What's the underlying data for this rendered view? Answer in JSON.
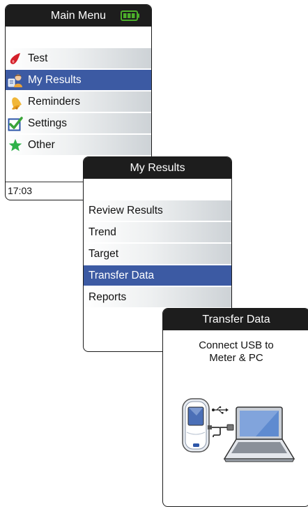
{
  "main_menu": {
    "title": "Main Menu",
    "items": [
      {
        "label": "Test",
        "icon": "blood-drop-icon"
      },
      {
        "label": "My Results",
        "icon": "user-results-icon",
        "selected": true
      },
      {
        "label": "Reminders",
        "icon": "bell-icon"
      },
      {
        "label": "Settings",
        "icon": "checkmark-icon"
      },
      {
        "label": "Other",
        "icon": "star-icon"
      }
    ],
    "time": "17:03",
    "battery_level": 1.0
  },
  "my_results": {
    "title": "My Results",
    "items": [
      {
        "label": "Review Results"
      },
      {
        "label": "Trend"
      },
      {
        "label": "Target"
      },
      {
        "label": "Transfer Data",
        "selected": true
      },
      {
        "label": "Reports"
      }
    ]
  },
  "transfer_data": {
    "title": "Transfer Data",
    "message_line1": "Connect USB to",
    "message_line2": "Meter & PC"
  },
  "colors": {
    "selection": "#3c5aa3",
    "titlebar": "#1d1d1d",
    "battery": "#4caf2a"
  }
}
